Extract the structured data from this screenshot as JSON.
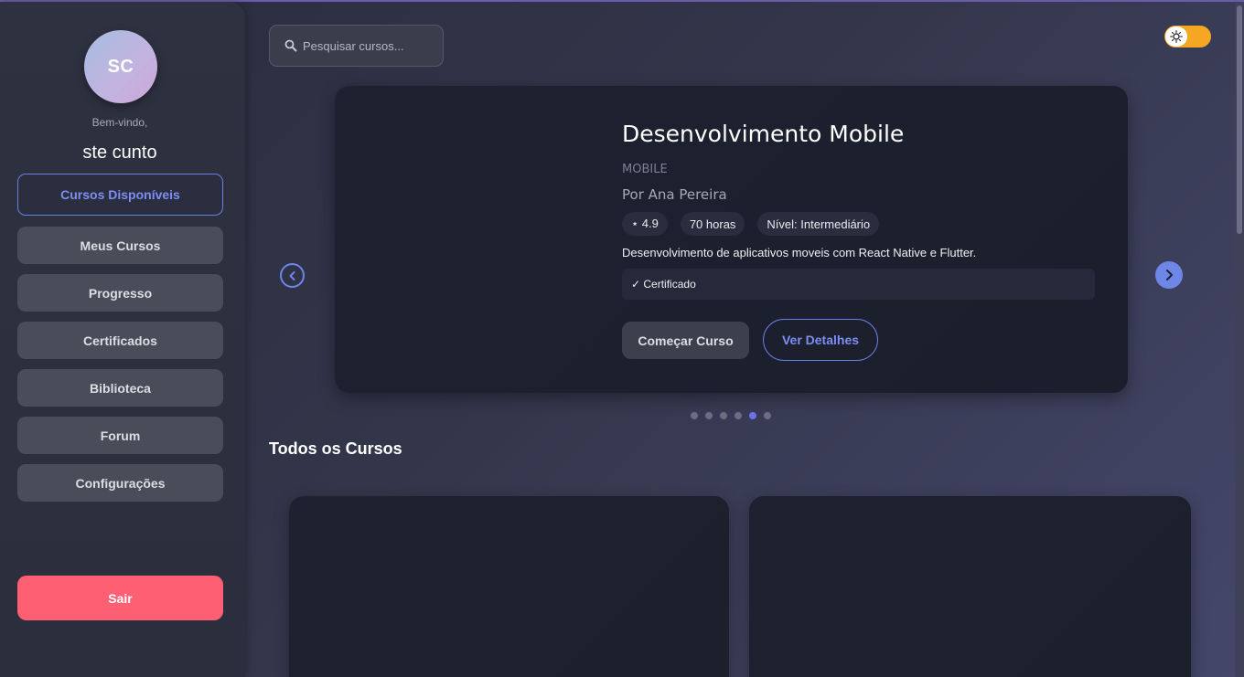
{
  "user": {
    "initials": "SC",
    "welcome": "Bem-vindo,",
    "name": "ste cunto"
  },
  "nav": {
    "items": [
      {
        "label": "Cursos Disponíveis",
        "active": true
      },
      {
        "label": "Meus Cursos",
        "active": false
      },
      {
        "label": "Progresso",
        "active": false
      },
      {
        "label": "Certificados",
        "active": false
      },
      {
        "label": "Biblioteca",
        "active": false
      },
      {
        "label": "Forum",
        "active": false
      },
      {
        "label": "Configurações",
        "active": false
      }
    ],
    "logout_label": "Sair"
  },
  "search": {
    "placeholder": "Pesquisar cursos..."
  },
  "theme_toggle": {
    "icon": "sun-icon",
    "state": "light"
  },
  "carousel": {
    "title": "Desenvolvimento Mobile",
    "category": "MOBILE",
    "author": "Por Ana Pereira",
    "rating": "⋆ 4.9",
    "hours": "70 horas",
    "level": "Nível: Intermediário",
    "description": "Desenvolvimento de aplicativos moveis com React Native e Flutter.",
    "feature": "✓ Certificado",
    "start_label": "Começar Curso",
    "details_label": "Ver Detalhes",
    "slide_count": 6,
    "active_slide": 5
  },
  "all_courses": {
    "title": "Todos os Cursos"
  },
  "colors": {
    "accent": "#6d86e8",
    "logout": "#ff5f73",
    "toggle": "#f5a623"
  }
}
